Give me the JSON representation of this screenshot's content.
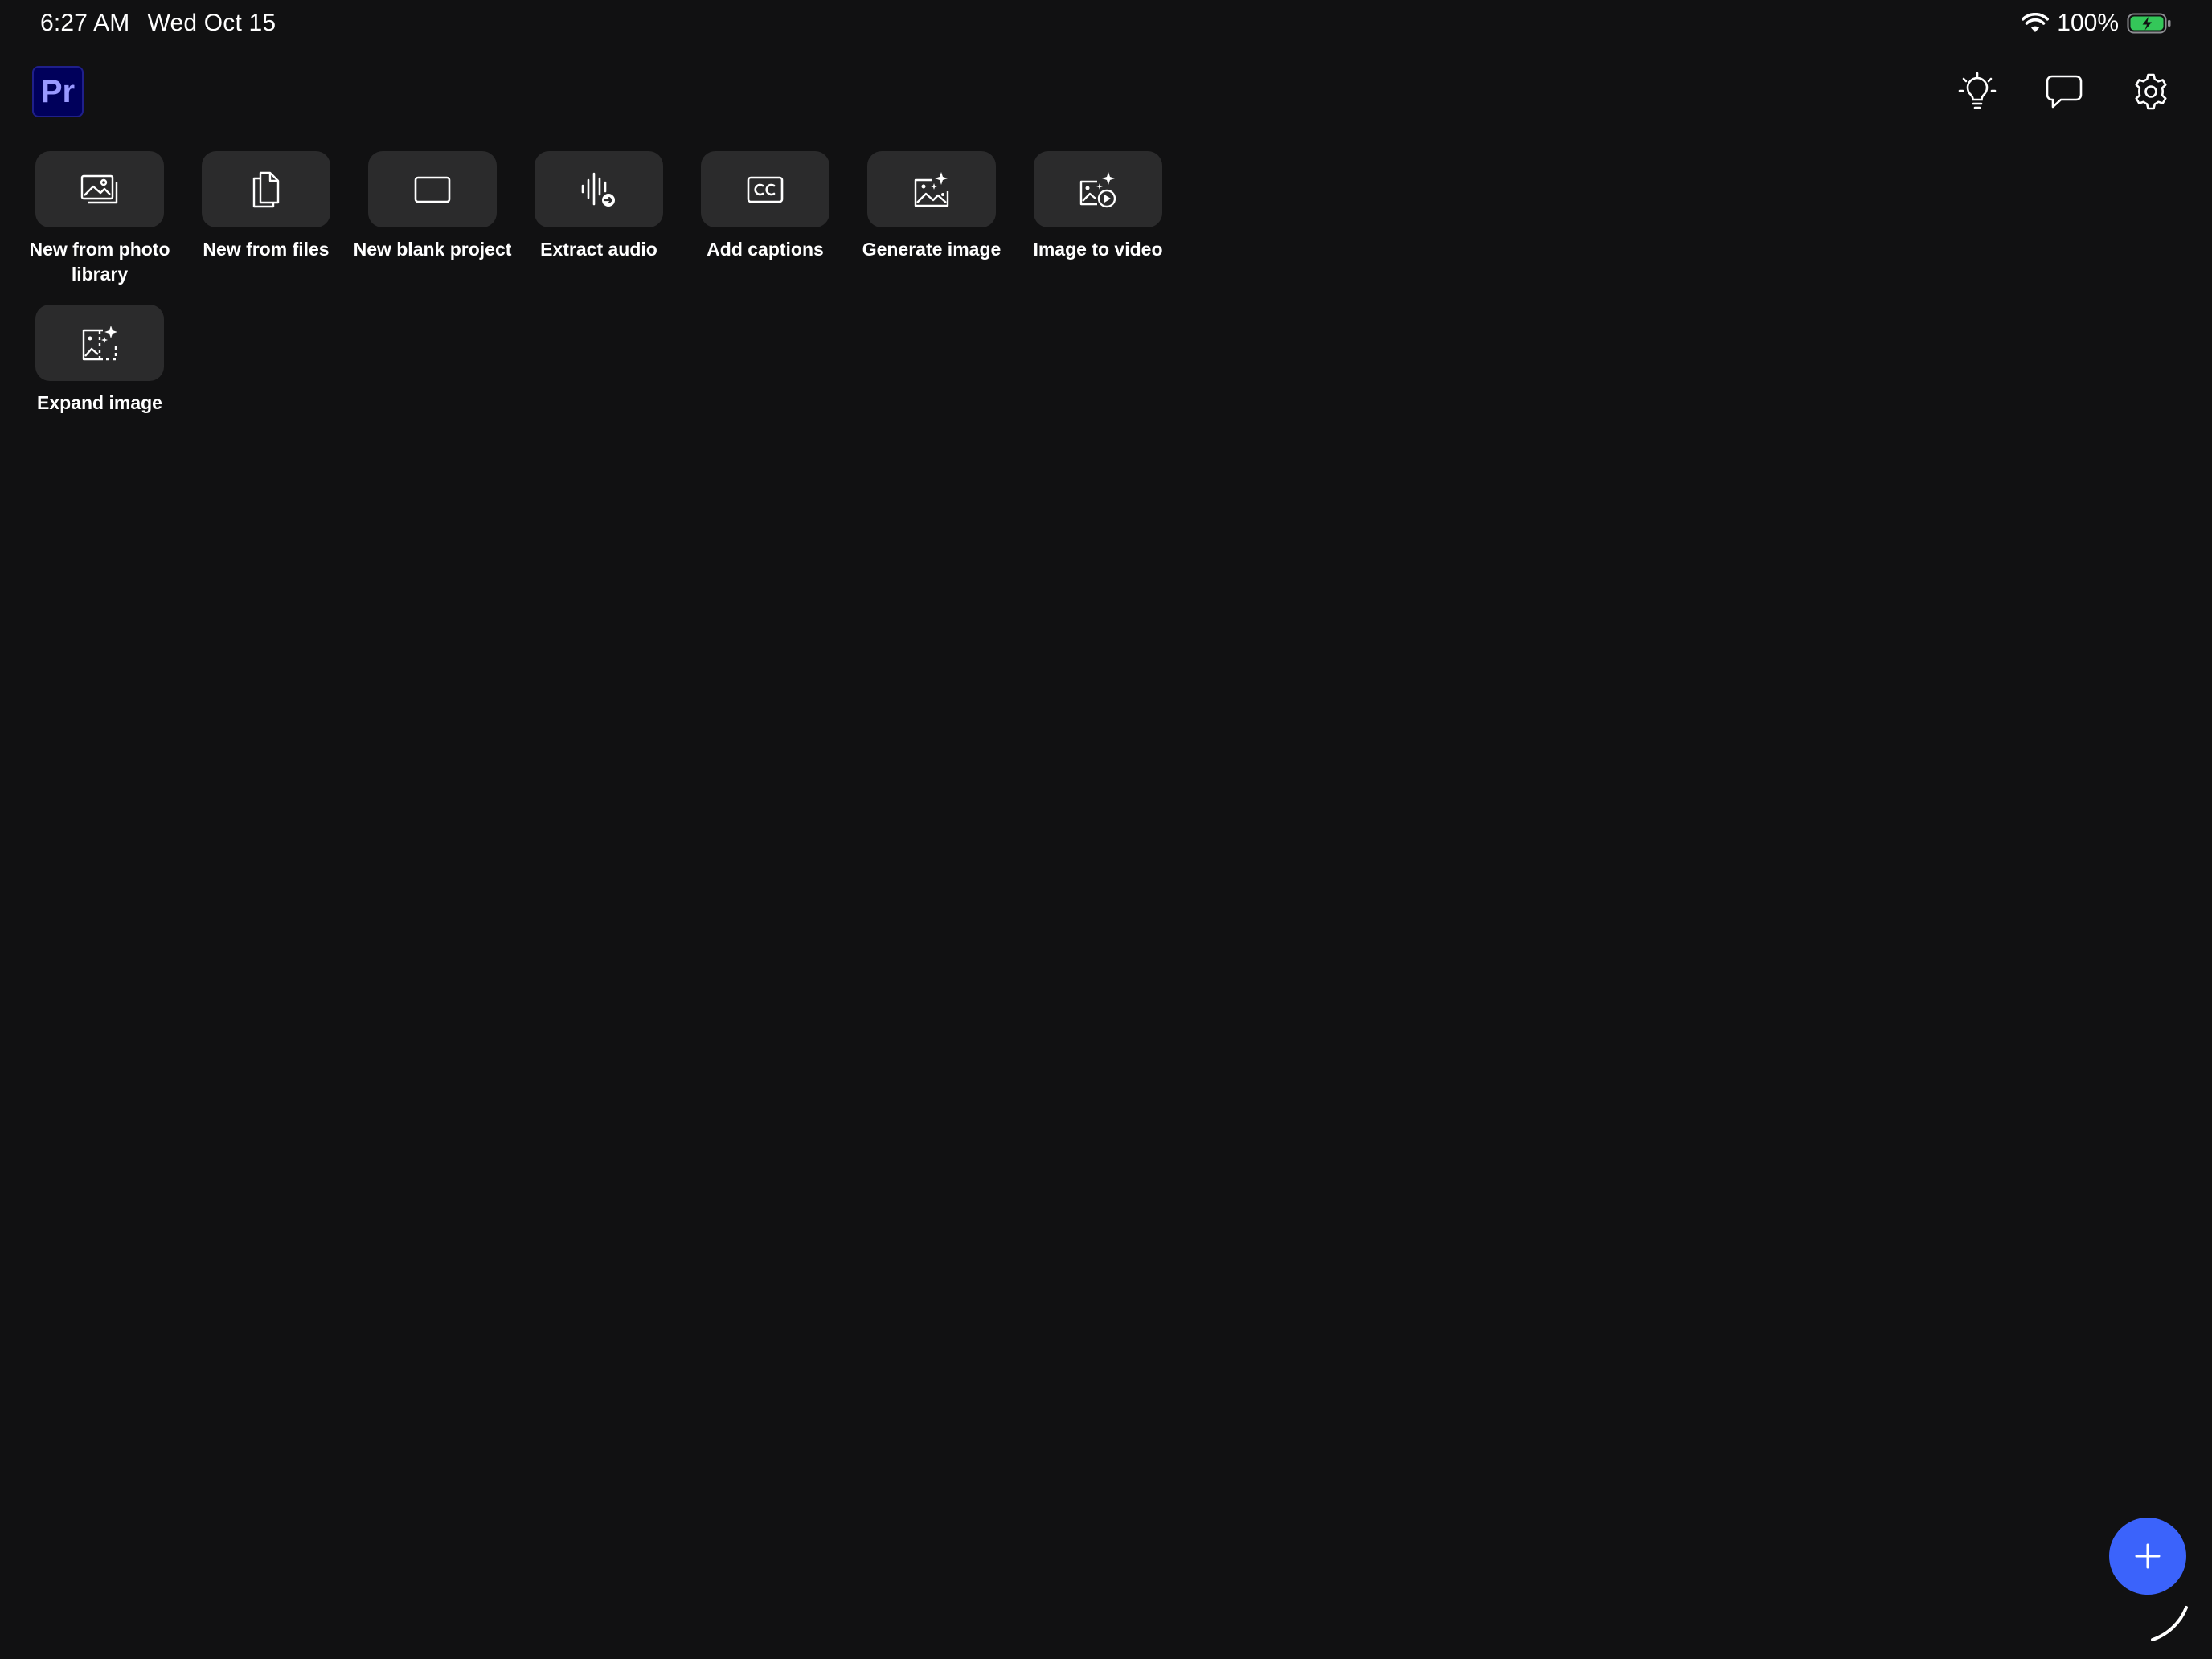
{
  "status_bar": {
    "time": "6:27 AM",
    "date": "Wed Oct 15",
    "battery_percent": "100%",
    "battery_level": 1.0,
    "battery_color": "#34c759",
    "icons": [
      "wifi-icon",
      "battery-charging-icon"
    ]
  },
  "app": {
    "logo_text": "Pr",
    "logo_bg": "#00005b",
    "logo_fg": "#9999ff"
  },
  "header": {
    "icons": [
      "lightbulb-icon",
      "chat-bubble-icon",
      "gear-icon"
    ]
  },
  "actions": [
    {
      "label": "New from photo library",
      "icon": "photo-library-icon"
    },
    {
      "label": "New from files",
      "icon": "files-icon"
    },
    {
      "label": "New blank project",
      "icon": "blank-rectangle-icon"
    },
    {
      "label": "Extract audio",
      "icon": "extract-audio-icon"
    },
    {
      "label": "Add captions",
      "icon": "cc-icon"
    },
    {
      "label": "Generate image",
      "icon": "generate-image-icon"
    },
    {
      "label": "Image to video",
      "icon": "image-to-video-icon"
    },
    {
      "label": "Expand image",
      "icon": "expand-image-icon"
    }
  ],
  "fab": {
    "icon": "plus-icon",
    "color": "#3b63fb"
  }
}
